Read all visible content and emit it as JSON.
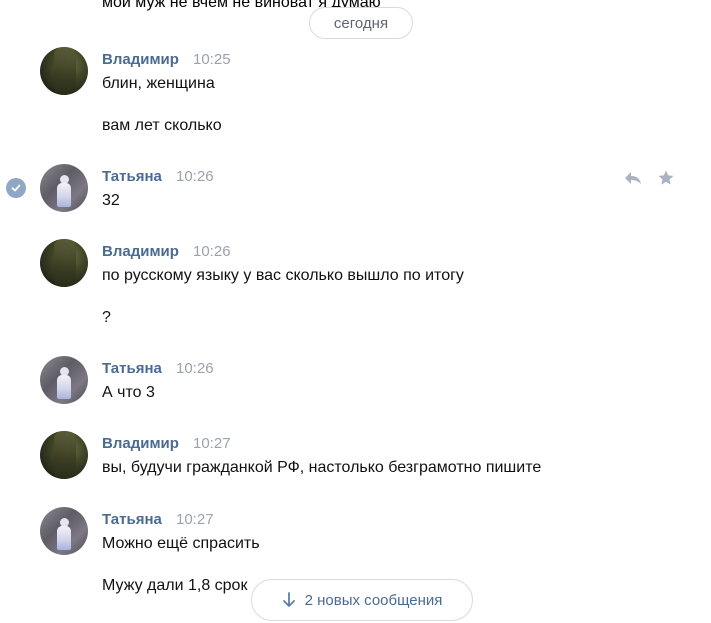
{
  "chat": {
    "partial_top_text": "мой муж не вчем не виноват я думаю",
    "date_label": "сегодня",
    "messages": [
      {
        "sender": "Владимир",
        "time": "10:25",
        "lines": [
          "блин, женщина",
          "вам лет сколько"
        ]
      },
      {
        "sender": "Татьяна",
        "time": "10:26",
        "lines": [
          "32"
        ]
      },
      {
        "sender": "Владимир",
        "time": "10:26",
        "lines": [
          "по русскому языку у вас сколько вышло по итогу",
          "?"
        ]
      },
      {
        "sender": "Татьяна",
        "time": "10:26",
        "lines": [
          "А что 3"
        ]
      },
      {
        "sender": "Владимир",
        "time": "10:27",
        "lines": [
          "вы, будучи гражданкой РФ, настолько безграмотно пишите"
        ]
      },
      {
        "sender": "Татьяна",
        "time": "10:27",
        "lines": [
          "Можно ещё спрасить",
          "Мужу дали 1,8 срок"
        ]
      }
    ],
    "new_messages_button": "2 новых сообщения"
  },
  "icons": {
    "read_check": "check-circle-icon",
    "reply": "reply-icon",
    "favorite": "star-icon",
    "scroll_down": "arrow-down-icon"
  },
  "colors": {
    "sender_name": "#4a6b93",
    "timestamp": "#9aa3ad",
    "message_text": "#111111",
    "pill_border": "#d6dbe1",
    "check_badge": "#8fa7c4",
    "action_icons": "#a9b4c0"
  }
}
